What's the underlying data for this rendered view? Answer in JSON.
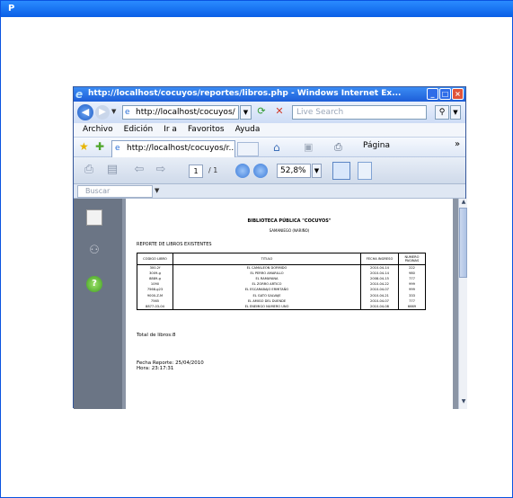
{
  "outer_window": {
    "title": "P"
  },
  "browser": {
    "title": "http://localhost/cocuyos/reportes/libros.php - Windows Internet Ex...",
    "address": "http://localhost/cocuyos/",
    "search_placeholder": "Live Search",
    "menu": [
      "Archivo",
      "Edición",
      "Ir a",
      "Favoritos",
      "Ayuda"
    ],
    "tab_label": "http://localhost/cocuyos/r...",
    "page_menu": "Página",
    "window_buttons": {
      "minimize": "_",
      "maximize": "□",
      "close": "×"
    }
  },
  "pdf_toolbar": {
    "page_current": "1",
    "page_total": "/ 1",
    "zoom": "52,8%",
    "find_placeholder": "Buscar"
  },
  "document": {
    "title": "BIBLIOTECA PÚBLICA \"COCUYOS\"",
    "subtitle": "SAMANIEGO (NARIÑO)",
    "report_heading": "REPORTE DE LIBROS EXISTENTES",
    "columns": [
      "CODIGO LIBRO",
      "TITULO",
      "FECHA INGRESO",
      "NUMERO PAGINAS"
    ],
    "rows": [
      [
        "300-2f",
        "EL CAMALEON DORMIDO",
        "2010-04-14",
        "222"
      ],
      [
        "3009-g",
        "EL PERRO AMARILLO",
        "2010-04-14",
        "980"
      ],
      [
        "8889-g",
        "EL RAMAYANA",
        "2008-04-15",
        "777"
      ],
      [
        "1090",
        "EL ZORRO ARTICO",
        "2010-04-22",
        "999"
      ],
      [
        "7568-g23",
        "EL ESCARABAJO ERMITAÑO",
        "2010-04-07",
        "999"
      ],
      [
        "9000-Z-M",
        "EL GATO SALVAJE",
        "2010-04-21",
        "333"
      ],
      [
        "7565",
        "EL AMIGO DEL DUENDE",
        "2010-04-07",
        "777"
      ],
      [
        "8877-03-04",
        "EL ENEMIGO NUMERO UNO",
        "2010-04-08",
        "6669"
      ]
    ],
    "total": "Total de libros:8",
    "report_date": "Fecha Reporte: 25/04/2010",
    "report_time": "Hora: 23:17:31"
  },
  "icons": {
    "back": "back-arrow-icon",
    "forward": "forward-arrow-icon",
    "refresh": "refresh-icon",
    "stop": "stop-icon",
    "search": "magnifier-icon",
    "favorites": "star-icon",
    "home": "home-icon",
    "print": "printer-icon"
  }
}
